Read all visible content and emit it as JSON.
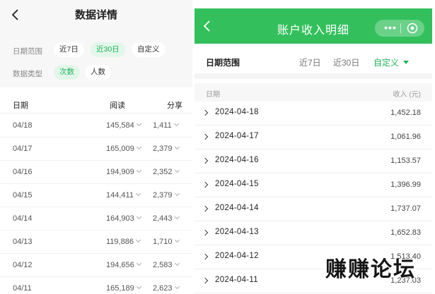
{
  "left": {
    "title": "数据详情",
    "filter": {
      "range_label": "日期范围",
      "range_options": [
        "近7日",
        "近30日",
        "自定义"
      ],
      "range_selected": "近30日",
      "type_label": "数据类型",
      "type_options": [
        "次数",
        "人数"
      ],
      "type_selected": "次数"
    },
    "table": {
      "headers": [
        "日期",
        "阅读",
        "分享"
      ],
      "rows": [
        {
          "date": "04/18",
          "read": "145,584",
          "share": "1,411"
        },
        {
          "date": "04/17",
          "read": "165,009",
          "share": "2,379"
        },
        {
          "date": "04/16",
          "read": "194,909",
          "share": "2,352"
        },
        {
          "date": "04/15",
          "read": "144,411",
          "share": "2,379"
        },
        {
          "date": "04/14",
          "read": "164,903",
          "share": "2,443"
        },
        {
          "date": "04/13",
          "read": "119,886",
          "share": "1,710"
        },
        {
          "date": "04/12",
          "read": "194,656",
          "share": "2,583"
        },
        {
          "date": "04/11",
          "read": "165,189",
          "share": "2,623"
        }
      ]
    }
  },
  "right": {
    "title": "账户收入明细",
    "range": {
      "label": "日期范围",
      "options": [
        "近7日",
        "近30日",
        "自定义"
      ],
      "selected": "自定义"
    },
    "table": {
      "headers": [
        "日期",
        "收入 (元)"
      ],
      "rows": [
        {
          "date": "2024-04-18",
          "amount": "1,452.18"
        },
        {
          "date": "2024-04-17",
          "amount": "1,061.96"
        },
        {
          "date": "2024-04-16",
          "amount": "1,153.57"
        },
        {
          "date": "2024-04-15",
          "amount": "1,396.99"
        },
        {
          "date": "2024-04-14",
          "amount": "1,737.07"
        },
        {
          "date": "2024-04-13",
          "amount": "1,652.83"
        },
        {
          "date": "2024-04-12",
          "amount": "1,513.40"
        },
        {
          "date": "2024-04-11",
          "amount": "1,237.03"
        }
      ]
    }
  },
  "watermark": "赚赚论坛",
  "colors": {
    "accent": "#33c05c",
    "accent_text": "#22b25a",
    "chip_on_bg": "#e3f6ea"
  },
  "icons": {
    "back": "chevron-left-icon",
    "more": "more-dots-icon",
    "close": "target-circle-icon",
    "row": "chevron-right-icon"
  }
}
